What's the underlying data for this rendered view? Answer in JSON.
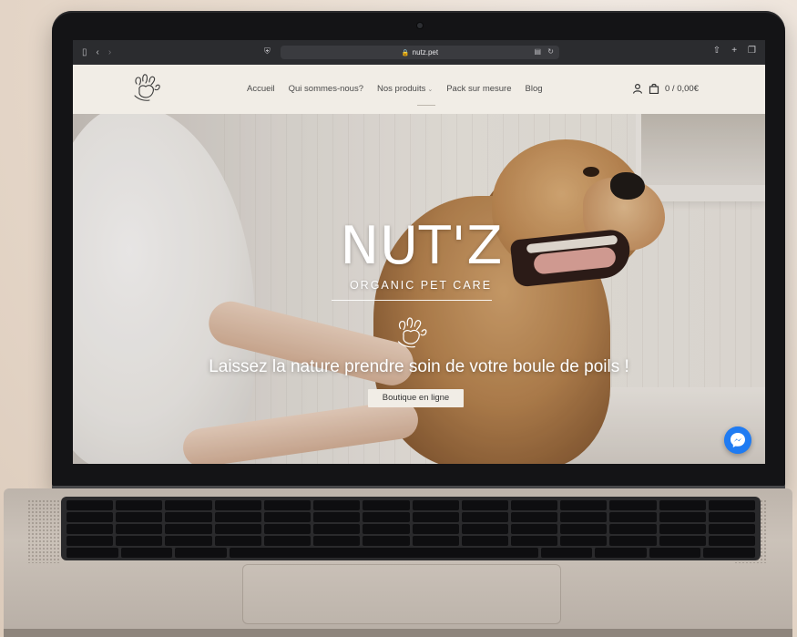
{
  "browser": {
    "url": "nutz.pet"
  },
  "header": {
    "nav": [
      {
        "label": "Accueil"
      },
      {
        "label": "Qui sommes-nous?"
      },
      {
        "label": "Nos produits",
        "has_dropdown": true
      },
      {
        "label": "Pack sur mesure"
      },
      {
        "label": "Blog"
      }
    ],
    "cart_summary": "0 / 0,00€"
  },
  "hero": {
    "brand": "NUT'Z",
    "tagline": "ORGANIC PET CARE",
    "headline": "Laissez la nature prendre soin de votre boule de poils !",
    "cta_label": "Boutique en ligne"
  },
  "colors": {
    "header_bg": "#f1ede6",
    "messenger_blue": "#1f7bf2",
    "browser_chrome": "#2b2c2f"
  },
  "icons": [
    "sidebar-toggle-icon",
    "back-icon",
    "forward-icon",
    "shield-icon",
    "lock-icon",
    "reader-icon",
    "reload-icon",
    "share-icon",
    "new-tab-icon",
    "tabs-icon",
    "paw-logo-icon",
    "user-icon",
    "shopping-bag-icon",
    "messenger-icon"
  ]
}
